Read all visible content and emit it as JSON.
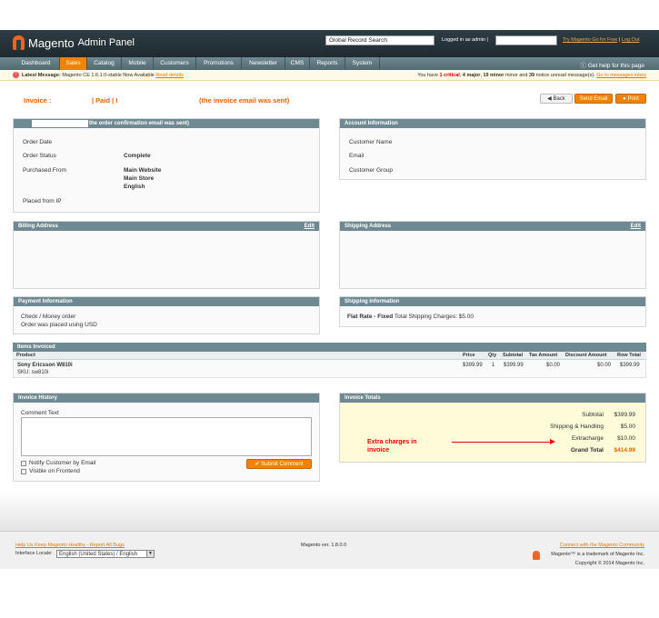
{
  "header": {
    "logo_text": "Magento",
    "logo_sub": "Admin Panel",
    "global_search": "Global Record Search",
    "logged_in": "Logged in as admin",
    "try_link": "Try Magento Go for Free",
    "logout": "Log Out"
  },
  "nav": {
    "items": [
      "Dashboard",
      "Sales",
      "Catalog",
      "Mobile",
      "Customers",
      "Promotions",
      "Newsletter",
      "CMS",
      "Reports",
      "System"
    ],
    "help": "Get help for this page"
  },
  "message": {
    "label": "Latest Message:",
    "text": "Magento CE 1.6.1.0-stable Now Available",
    "link": "Read details",
    "right_prefix": "You have",
    "critical": "1 critical",
    "major": "4 major",
    "minor": "19 minor",
    "notice": "39 notice unread message(s).",
    "inbox_link": "Go to messages inbox"
  },
  "title": {
    "invoice": "Invoice :",
    "paid": "| Paid | I",
    "email": "(the invoice email was sent)"
  },
  "buttons": {
    "back": "Back",
    "send_email": "Send Email",
    "print": "Print"
  },
  "order": {
    "header": "the order confirmation email was sent)",
    "order_date_label": "Order Date",
    "status_label": "Order Status",
    "status_value": "Complete",
    "purchased_label": "Purchased From",
    "purchased_lines": [
      "Main Website",
      "Main Store",
      "English"
    ],
    "placed_ip_label": "Placed from IP"
  },
  "account": {
    "header": "Account Information",
    "name_label": "Customer Name",
    "email_label": "Email",
    "group_label": "Customer Group"
  },
  "billing": {
    "header": "Billing Address",
    "edit": "Edit"
  },
  "shipping_address": {
    "header": "Shipping Address",
    "edit": "Edit"
  },
  "payment": {
    "header": "Payment Information",
    "method": "Check / Money order",
    "currency_note": "Order was placed using USD"
  },
  "shipping_info": {
    "header": "Shipping Information",
    "method_bold": "Flat Rate - Fixed",
    "method_rest": "Total Shipping Charges: $5.00"
  },
  "items": {
    "header": "Items Invoiced",
    "columns": [
      "Product",
      "Price",
      "Qty",
      "Subtotal",
      "Tax Amount",
      "Discount Amount",
      "Row Total"
    ],
    "rows": [
      {
        "product": "Sony Ericsson W810i",
        "sku": "SKU: sw810i",
        "price": "$399.99",
        "qty": "1",
        "subtotal": "$399.99",
        "tax": "$0.00",
        "discount": "$0.00",
        "row_total": "$399.99"
      }
    ]
  },
  "history": {
    "header": "Invoice History",
    "comment_label": "Comment Text",
    "notify": "Notify Customer by Email",
    "visible": "Visible on Frontend",
    "submit": "Submit Comment"
  },
  "totals": {
    "header": "Invoice Totals",
    "rows": [
      {
        "label": "Subtotal",
        "value": "$399.99"
      },
      {
        "label": "Shipping & Handling",
        "value": "$5.00"
      },
      {
        "label": "Extracharge",
        "value": "$10.00"
      },
      {
        "label": "Grand Total",
        "value": "$414.99"
      }
    ],
    "annotation_line1": "Extra charges in",
    "annotation_line2": "invoice"
  },
  "footer": {
    "help_link": "Help Us Keep Magento Healthy - Report All Bugs",
    "locale_label": "Interface Locale:",
    "locale_value": "English (United States) / English",
    "version": "Magento ver. 1.8.0.0",
    "community_link": "Connect with the Magento Community",
    "trademark": "Magento™ is a trademark of Magento Inc.",
    "copyright": "Copyright © 2014 Magento Inc."
  },
  "colors": {
    "accent": "#f18200",
    "header_bg": "#2d3d44",
    "box_head": "#6f8992",
    "annotation": "#e00000"
  }
}
